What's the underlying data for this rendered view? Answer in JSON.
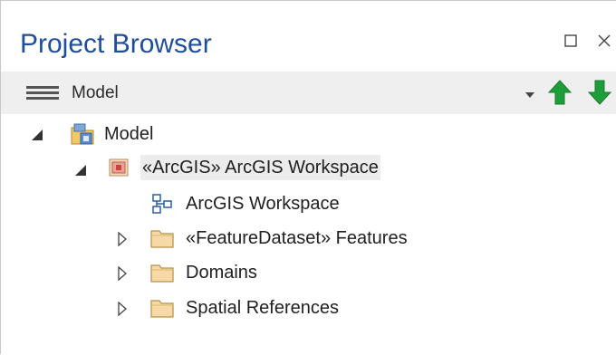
{
  "window": {
    "title": "Project Browser",
    "restore_icon": "restore-icon",
    "close_icon": "close-icon"
  },
  "toolbar": {
    "menu_icon": "hamburger-menu-icon",
    "label": "Model",
    "dropdown_icon": "dropdown-arrow-icon",
    "move_up_icon": "green-arrow-up-icon",
    "move_down_icon": "green-arrow-down-icon",
    "accent_up_color": "#1e9e3a",
    "accent_down_color": "#1e9e3a"
  },
  "tree": {
    "root": {
      "label": "Model",
      "expanded": true,
      "icon": "model-root-icon"
    },
    "workspace": {
      "label": "«ArcGIS» ArcGIS Workspace",
      "expanded": true,
      "icon": "package-icon",
      "selected": true
    },
    "children": [
      {
        "label": "ArcGIS Workspace",
        "icon": "diagram-icon",
        "expandable": false
      },
      {
        "label": "«FeatureDataset» Features",
        "icon": "folder-icon",
        "expandable": true
      },
      {
        "label": "Domains",
        "icon": "folder-icon",
        "expandable": true
      },
      {
        "label": "Spatial References",
        "icon": "folder-icon",
        "expandable": true
      }
    ]
  }
}
